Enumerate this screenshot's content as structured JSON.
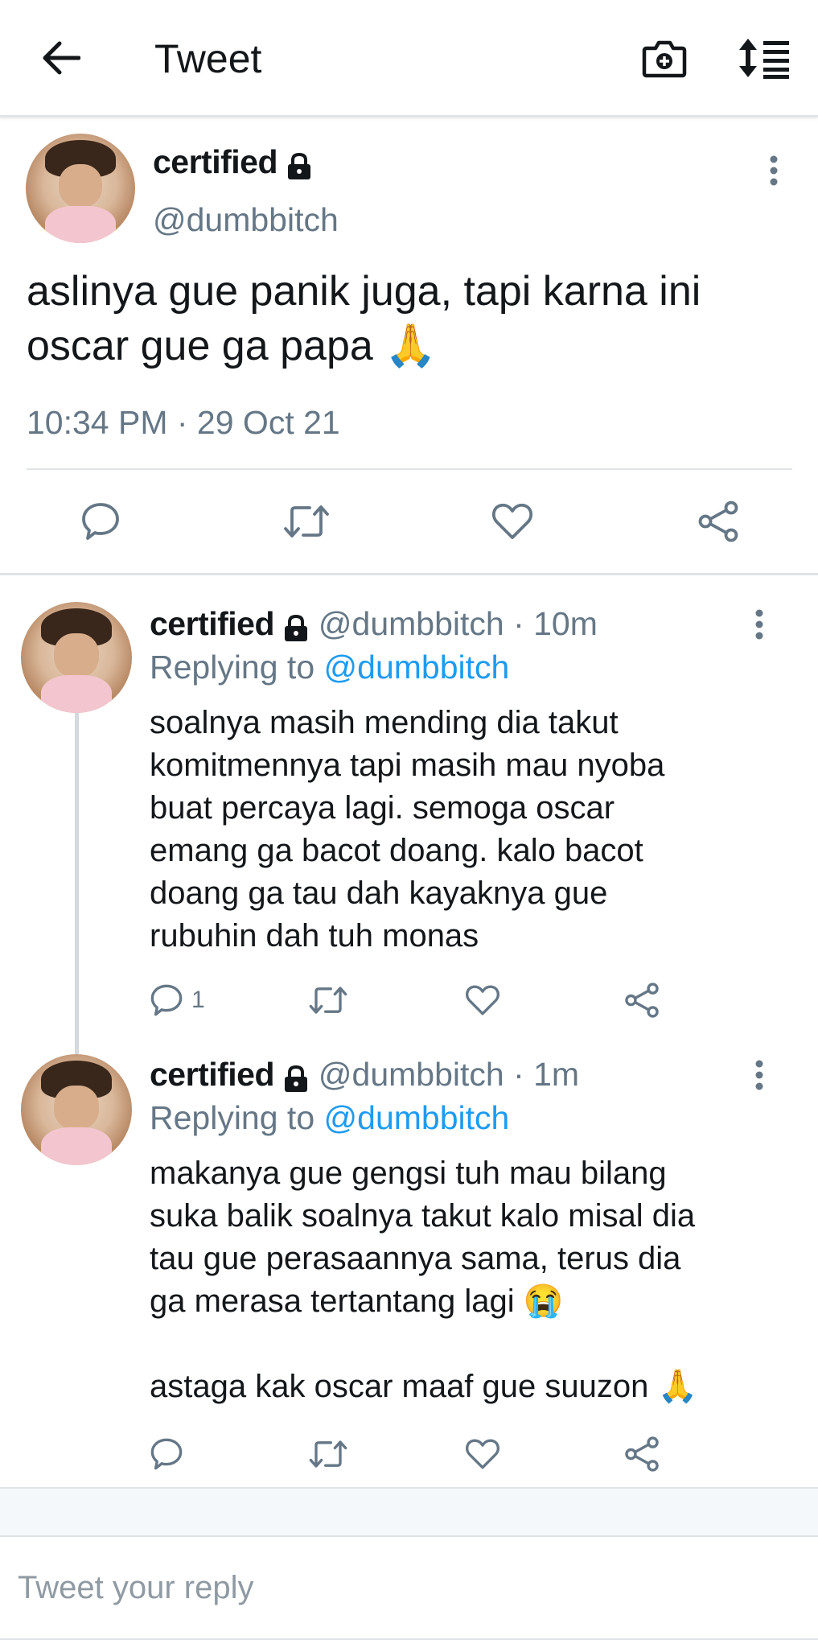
{
  "header": {
    "title": "Tweet",
    "back_icon": "arrow-left-icon",
    "camera_icon": "camera-plus-icon",
    "sort_icon": "sort-list-icon"
  },
  "main_tweet": {
    "name": "certified",
    "handle": "@dumbbitch",
    "text": "aslinya gue panik juga, tapi karna ini oscar gue ga papa 🙏",
    "timestamp": "10:34 PM · 29 Oct 21"
  },
  "replies": [
    {
      "name": "certified",
      "handle_time": "@dumbbitch · 10m",
      "replying_prefix": "Replying to",
      "replying_to": "@dumbbitch",
      "lines": [
        "soalnya masih mending dia takut",
        "komitmennya tapi masih mau nyoba",
        "buat percaya lagi. semoga oscar",
        "emang ga bacot doang. kalo bacot",
        "doang ga tau dah kayaknya gue",
        "rubuhin dah tuh monas"
      ],
      "reply_count": "1"
    },
    {
      "name": "certified",
      "handle_time": "@dumbbitch · 1m",
      "replying_prefix": "Replying to",
      "replying_to": "@dumbbitch",
      "lines": [
        "makanya gue gengsi tuh mau bilang",
        "suka balik soalnya takut kalo misal dia",
        "tau gue perasaannya sama, terus dia",
        "ga merasa tertantang lagi 😭",
        "",
        "astaga kak oscar maaf gue suuzon 🙏"
      ]
    }
  ],
  "reply_box": {
    "placeholder": "Tweet your reply"
  },
  "colors": {
    "accent": "#1d9bf0",
    "secondary_text": "#657786",
    "divider": "#e1e4e7"
  }
}
